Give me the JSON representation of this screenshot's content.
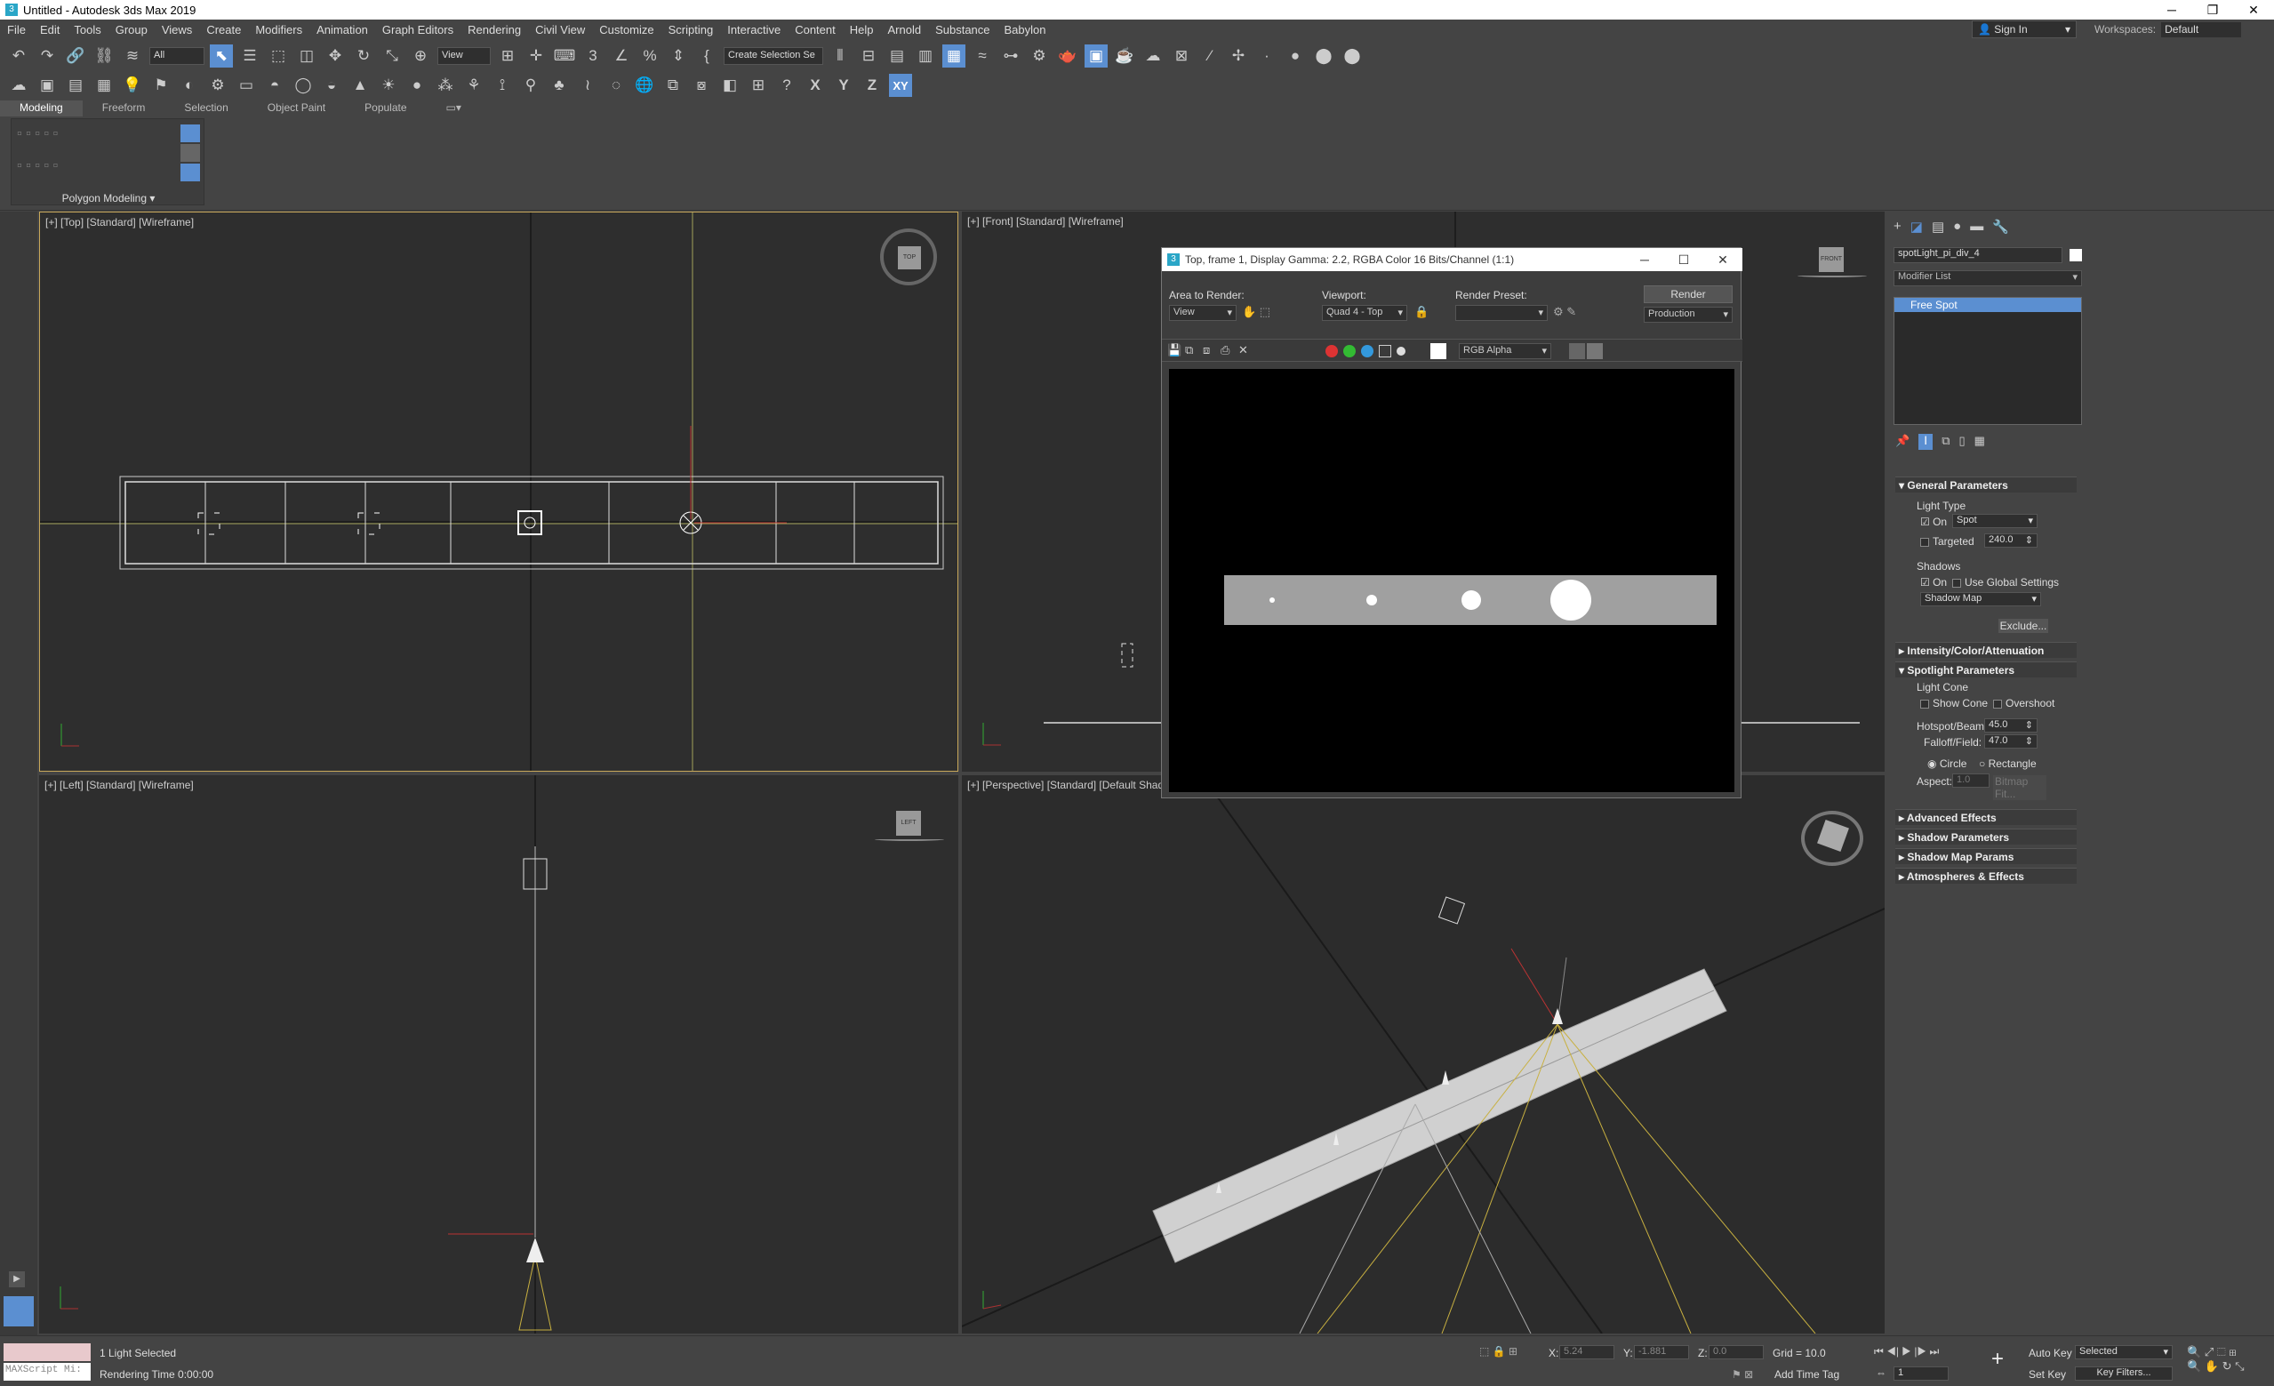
{
  "window": {
    "title": "Untitled - Autodesk 3ds Max 2019",
    "minimize": "─",
    "restore": "❐",
    "close": "✕"
  },
  "menu": [
    "File",
    "Edit",
    "Tools",
    "Group",
    "Views",
    "Create",
    "Modifiers",
    "Animation",
    "Graph Editors",
    "Rendering",
    "Civil View",
    "Customize",
    "Scripting",
    "Interactive",
    "Content",
    "Help",
    "Arnold",
    "Substance",
    "Babylon"
  ],
  "account": {
    "sign_in": "Sign In",
    "workspaces_label": "Workspaces:",
    "workspace": "Default"
  },
  "toolbar1": {
    "selection_filter": "All",
    "ref_coord": "View",
    "named_selection": "Create Selection Se"
  },
  "toolbar2": {
    "axes": [
      "X",
      "Y",
      "Z",
      "XY"
    ]
  },
  "ribbon": {
    "tabs": [
      "Modeling",
      "Freeform",
      "Selection",
      "Object Paint",
      "Populate"
    ],
    "panel": "Polygon Modeling"
  },
  "viewports": {
    "top": "[+] [Top] [Standard] [Wireframe]",
    "front": "[+] [Front] [Standard] [Wireframe]",
    "left": "[+] [Left] [Standard] [Wireframe]",
    "perspective": "[+] [Perspective] [Standard] [Default Shad"
  },
  "viewcube": {
    "top": "TOP",
    "front": "FRONT",
    "left": "LEFT"
  },
  "render_window": {
    "title": "Top, frame 1, Display Gamma: 2.2, RGBA Color 16 Bits/Channel (1:1)",
    "area_label": "Area to Render:",
    "area": "View",
    "viewport_label": "Viewport:",
    "viewport": "Quad 4 - Top",
    "preset_label": "Render Preset:",
    "preset": "",
    "render_button": "Render",
    "render_mode": "Production",
    "channel": "RGB Alpha"
  },
  "command_panel": {
    "object_name": "spotLight_pi_div_4",
    "modifier_list": "Modifier List",
    "stack_item": "Free Spot",
    "general": {
      "title": "General Parameters",
      "light_type": "Light Type",
      "on": "On",
      "type": "Spot",
      "targeted": "Targeted",
      "target_dist": "240.0",
      "shadows": "Shadows",
      "shadows_on": "On",
      "use_global": "Use Global Settings",
      "shadow_type": "Shadow Map",
      "exclude": "Exclude..."
    },
    "intensity": "Intensity/Color/Attenuation",
    "spot": {
      "title": "Spotlight Parameters",
      "light_cone": "Light Cone",
      "show_cone": "Show Cone",
      "overshoot": "Overshoot",
      "hotspot_label": "Hotspot/Beam:",
      "hotspot": "45.0",
      "falloff_label": "Falloff/Field:",
      "falloff": "47.0",
      "circle": "Circle",
      "rectangle": "Rectangle",
      "aspect_label": "Aspect:",
      "aspect": "1.0",
      "bitmap_fit": "Bitmap Fit..."
    },
    "advanced": "Advanced Effects",
    "shadow_params": "Shadow Parameters",
    "shadow_map_params": "Shadow Map Params",
    "atmos": "Atmospheres & Effects"
  },
  "status": {
    "maxscript": "MAXScript Mi:",
    "selected": "1 Light Selected",
    "render_time": "Rendering Time  0:00:00",
    "x_label": "X:",
    "x": "5.24",
    "y_label": "Y:",
    "y": "-1.881",
    "z_label": "Z:",
    "z": "0.0",
    "grid": "Grid = 10.0",
    "add_time_tag": "Add Time Tag",
    "auto_key": "Auto Key",
    "set_key": "Set Key",
    "key_mode": "Selected",
    "key_filters": "Key Filters...",
    "frame": "1"
  }
}
